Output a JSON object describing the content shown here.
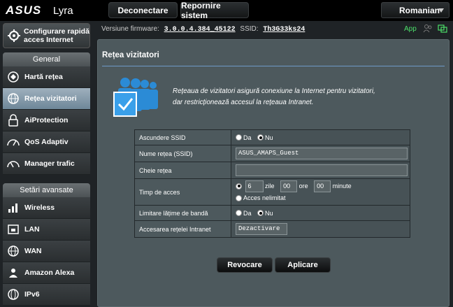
{
  "header": {
    "brand": "ASUS",
    "model": "Lyra",
    "logout": "Deconectare",
    "reboot": "Repornire sistem",
    "language": "Romanian"
  },
  "status": {
    "firmware_label": "Versiune firmware:",
    "firmware_value": "3.0.0.4.384_45122",
    "ssid_label": "SSID:",
    "ssid_value": "Th3G33ks24",
    "app_label": "App"
  },
  "sidebar": {
    "quick_setup": "Configurare rapidă acces Internet",
    "general_title": "General",
    "general_items": [
      {
        "label": "Hartă rețea",
        "icon": "network-map-icon"
      },
      {
        "label": "Rețea vizitatori",
        "icon": "guest-network-icon"
      },
      {
        "label": "AiProtection",
        "icon": "aiprotection-icon"
      },
      {
        "label": "QoS Adaptiv",
        "icon": "qos-icon"
      },
      {
        "label": "Manager trafic",
        "icon": "traffic-manager-icon"
      }
    ],
    "advanced_title": "Setări avansate",
    "advanced_items": [
      {
        "label": "Wireless",
        "icon": "wireless-icon"
      },
      {
        "label": "LAN",
        "icon": "lan-icon"
      },
      {
        "label": "WAN",
        "icon": "wan-icon"
      },
      {
        "label": "Amazon Alexa",
        "icon": "alexa-icon"
      },
      {
        "label": "IPv6",
        "icon": "ipv6-icon"
      }
    ]
  },
  "main": {
    "title": "Rețea vizitatori",
    "description": "Rețeaua de vizitatori asigură conexiune la Internet pentru vizitatori, dar restricționează accesul la rețeaua Intranet.",
    "form": {
      "hide_ssid_label": "Ascundere SSID",
      "yes": "Da",
      "no": "Nu",
      "ssid_label": "Nume rețea (SSID)",
      "ssid_value": "ASUS_AMAPS_Guest",
      "key_label": "Cheie rețea",
      "key_value": "",
      "access_time_label": "Timp de acces",
      "days_value": "6",
      "days_unit": "zile",
      "hours_value": "00",
      "hours_unit": "ore",
      "minutes_value": "00",
      "minutes_unit": "minute",
      "unlimited_label": "Acces nelimitat",
      "bandwidth_label": "Limitare lățime de bandă",
      "intranet_label": "Accesarea rețelei Intranet",
      "intranet_value": "Dezactivare"
    },
    "cancel": "Revocare",
    "apply": "Aplicare"
  },
  "colors": {
    "background": "#1f2326",
    "panel": "#4d595d",
    "accent_line": "#6e9ac8",
    "app_green": "#4ce06a"
  }
}
